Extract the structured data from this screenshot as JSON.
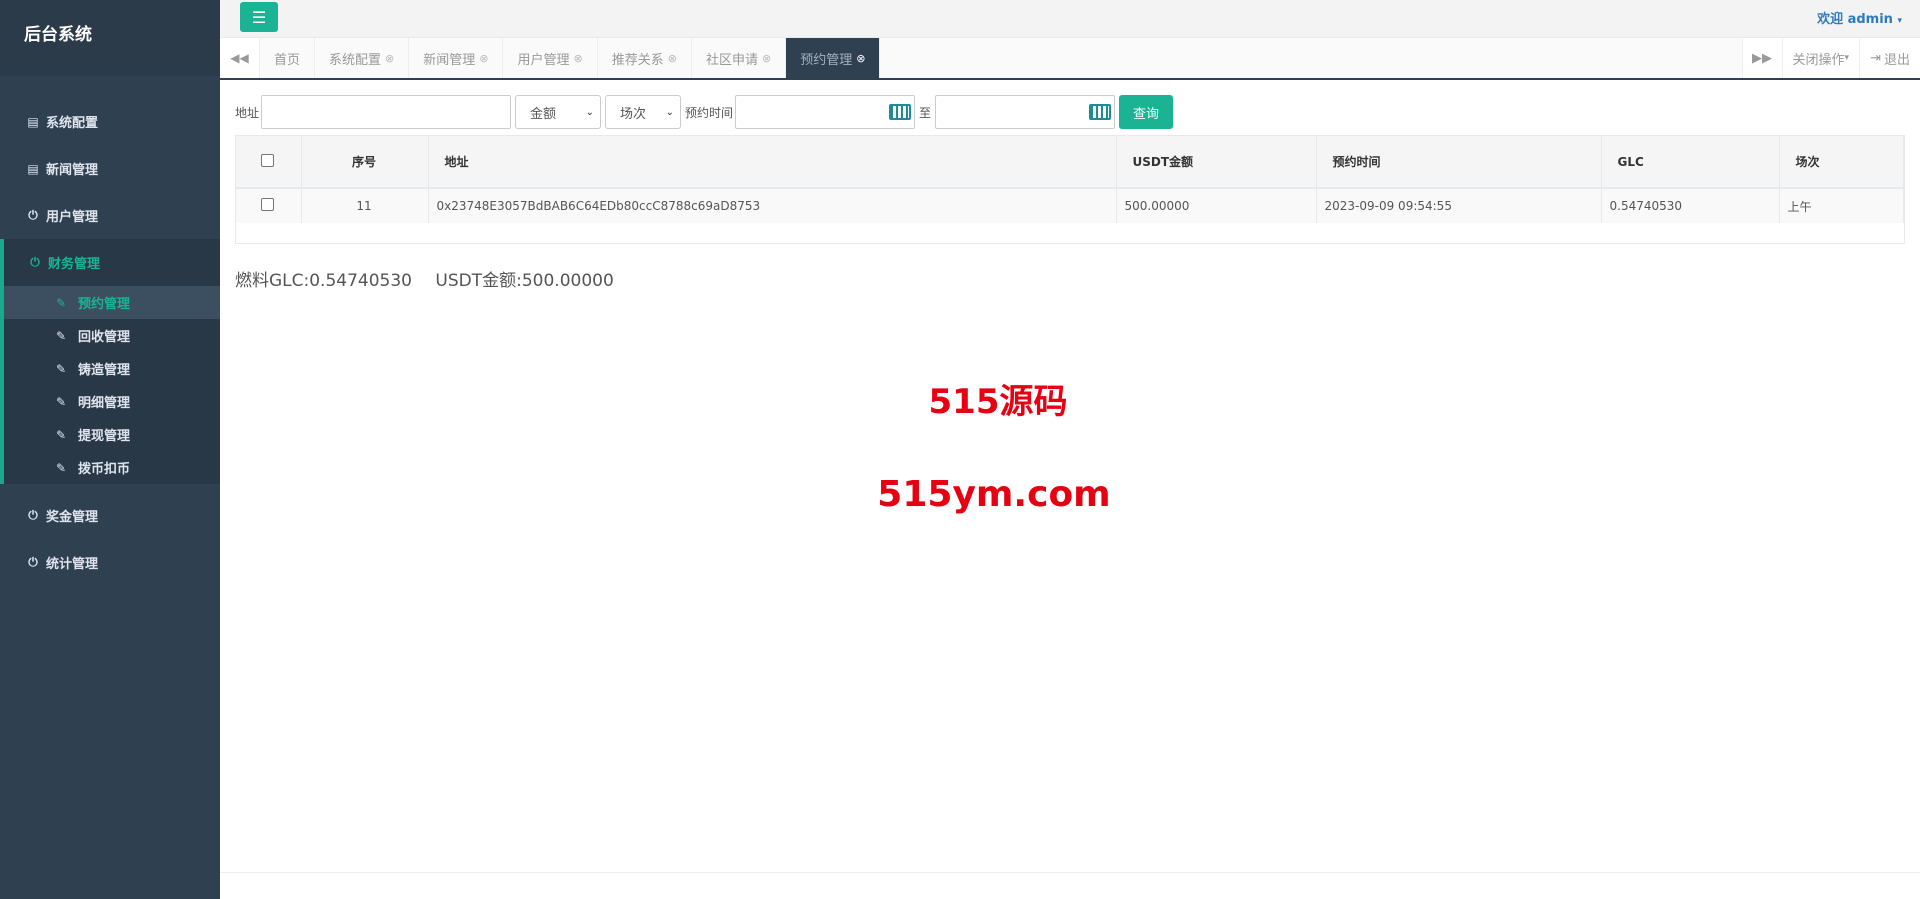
{
  "brand": "后台系统",
  "sidebar": {
    "items": [
      {
        "label": "系统配置",
        "icon": "document-icon"
      },
      {
        "label": "新闻管理",
        "icon": "document-icon"
      },
      {
        "label": "用户管理",
        "icon": "power-icon"
      },
      {
        "label": "财务管理",
        "icon": "power-icon"
      },
      {
        "label": "奖金管理",
        "icon": "power-icon"
      },
      {
        "label": "统计管理",
        "icon": "power-icon"
      }
    ],
    "sub_items": [
      {
        "label": "预约管理"
      },
      {
        "label": "回收管理"
      },
      {
        "label": "铸造管理"
      },
      {
        "label": "明细管理"
      },
      {
        "label": "提现管理"
      },
      {
        "label": "拨币扣币"
      }
    ]
  },
  "header": {
    "welcome": "欢迎 admin"
  },
  "tabs": [
    {
      "label": "首页"
    },
    {
      "label": "系统配置"
    },
    {
      "label": "新闻管理"
    },
    {
      "label": "用户管理"
    },
    {
      "label": "推荐关系"
    },
    {
      "label": "社区申请"
    },
    {
      "label": "预约管理"
    }
  ],
  "tab_controls": {
    "close_ops": "关闭操作",
    "logout": "退出"
  },
  "filters": {
    "address_label": "地址",
    "amount_select": "金额",
    "session_select": "场次",
    "time_label": "预约时间",
    "to_label": "至",
    "query_button": "查询"
  },
  "table": {
    "headers": [
      "序号",
      "地址",
      "USDT金额",
      "预约时间",
      "GLC",
      "场次"
    ],
    "rows": [
      {
        "id": "11",
        "address": "0x23748E3057BdBAB6C64EDb80ccC8788c69aD8753",
        "usdt": "500.00000",
        "time": "2023-09-09 09:54:55",
        "glc": "0.54740530",
        "session": "上午"
      }
    ]
  },
  "summary": {
    "glc": "燃料GLC:0.54740530",
    "usdt": "USDT金额:500.00000"
  },
  "watermark": {
    "line1": "515源码",
    "line2": "515ym.com"
  },
  "colors": {
    "sidebar": "#2f4050",
    "accent": "#1ab394",
    "watermark": "#e60012"
  }
}
